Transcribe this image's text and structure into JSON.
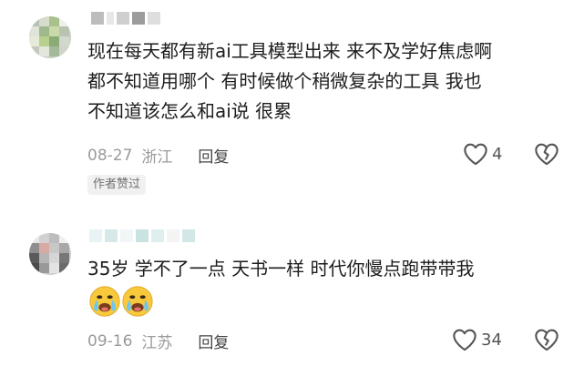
{
  "comments": [
    {
      "text_lines": [
        "现在每天都有新ai工具模型出来 来不及学好焦虑啊",
        "都不知道用哪个 有时候做个稍微复杂的工具 我也",
        "不知道该怎么和ai说 很累"
      ],
      "date": "08-27",
      "location": "浙江",
      "reply_label": "回复",
      "like_count": "4",
      "author_badge": "作者赞过"
    },
    {
      "text_lines": [
        "35岁 学不了一点 天书一样 时代你慢点跑带带我"
      ],
      "emoji_names": [
        "crying-face-emoji",
        "crying-face-emoji"
      ],
      "date": "09-16",
      "location": "江苏",
      "reply_label": "回复",
      "like_count": "34"
    }
  ],
  "icons": [
    "heart-outline-icon",
    "broken-heart-icon"
  ]
}
